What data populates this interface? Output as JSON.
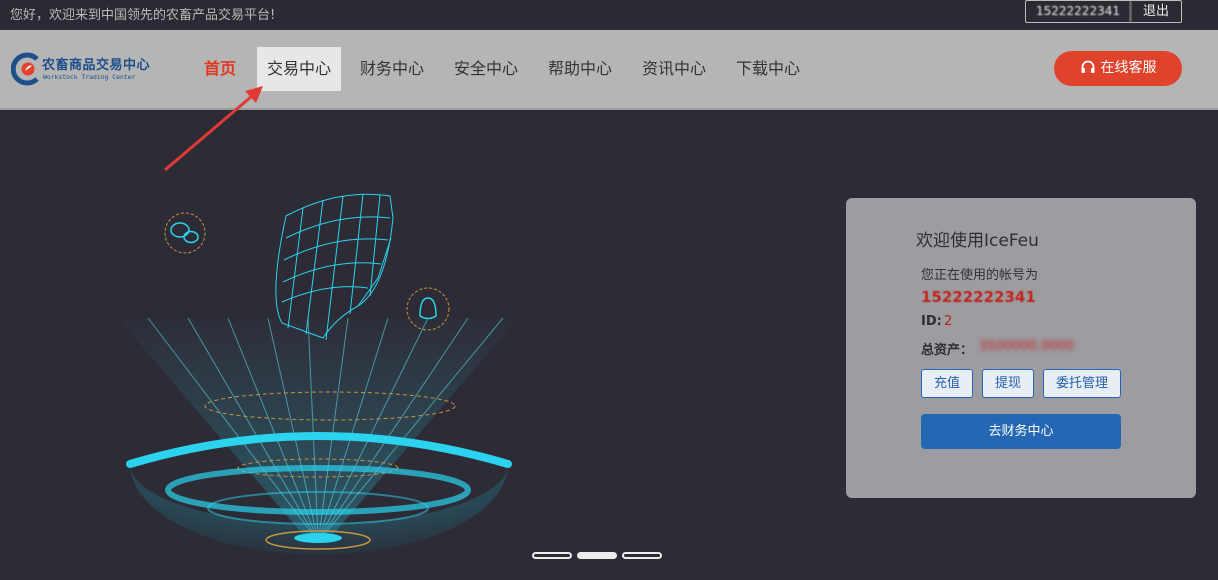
{
  "topbar": {
    "welcome": "您好，欢迎来到中国领先的农畜产品交易平台!",
    "account": "15222222341",
    "logout": "退出"
  },
  "logo": {
    "title": "农畜商品交易中心",
    "subtitle": "Workstock Trading Center"
  },
  "nav": {
    "items": [
      {
        "label": "首页"
      },
      {
        "label": "交易中心"
      },
      {
        "label": "财务中心"
      },
      {
        "label": "安全中心"
      },
      {
        "label": "帮助中心"
      },
      {
        "label": "资讯中心"
      },
      {
        "label": "下载中心"
      }
    ],
    "service_label": "在线客服",
    "active_index": 0,
    "highlighted_index": 1
  },
  "panel": {
    "title": "欢迎使用IceFeu",
    "caption": "您正在使用的帐号为",
    "account": "15222222341",
    "id_label": "ID:",
    "id_value": "2",
    "asset_label": "总资产：",
    "asset_value": "3500000.0000",
    "recharge": "充值",
    "withdraw": "提现",
    "orders": "委托管理",
    "go_finance": "去财务中心"
  },
  "carousel": {
    "count": 3,
    "active_index": 1
  },
  "colors": {
    "accent": "#e0432b",
    "primary_button": "#2467b2",
    "header_bg": "#b5b5b5",
    "page_bg": "#2d2c36",
    "hologram": "#2bd3ee"
  }
}
